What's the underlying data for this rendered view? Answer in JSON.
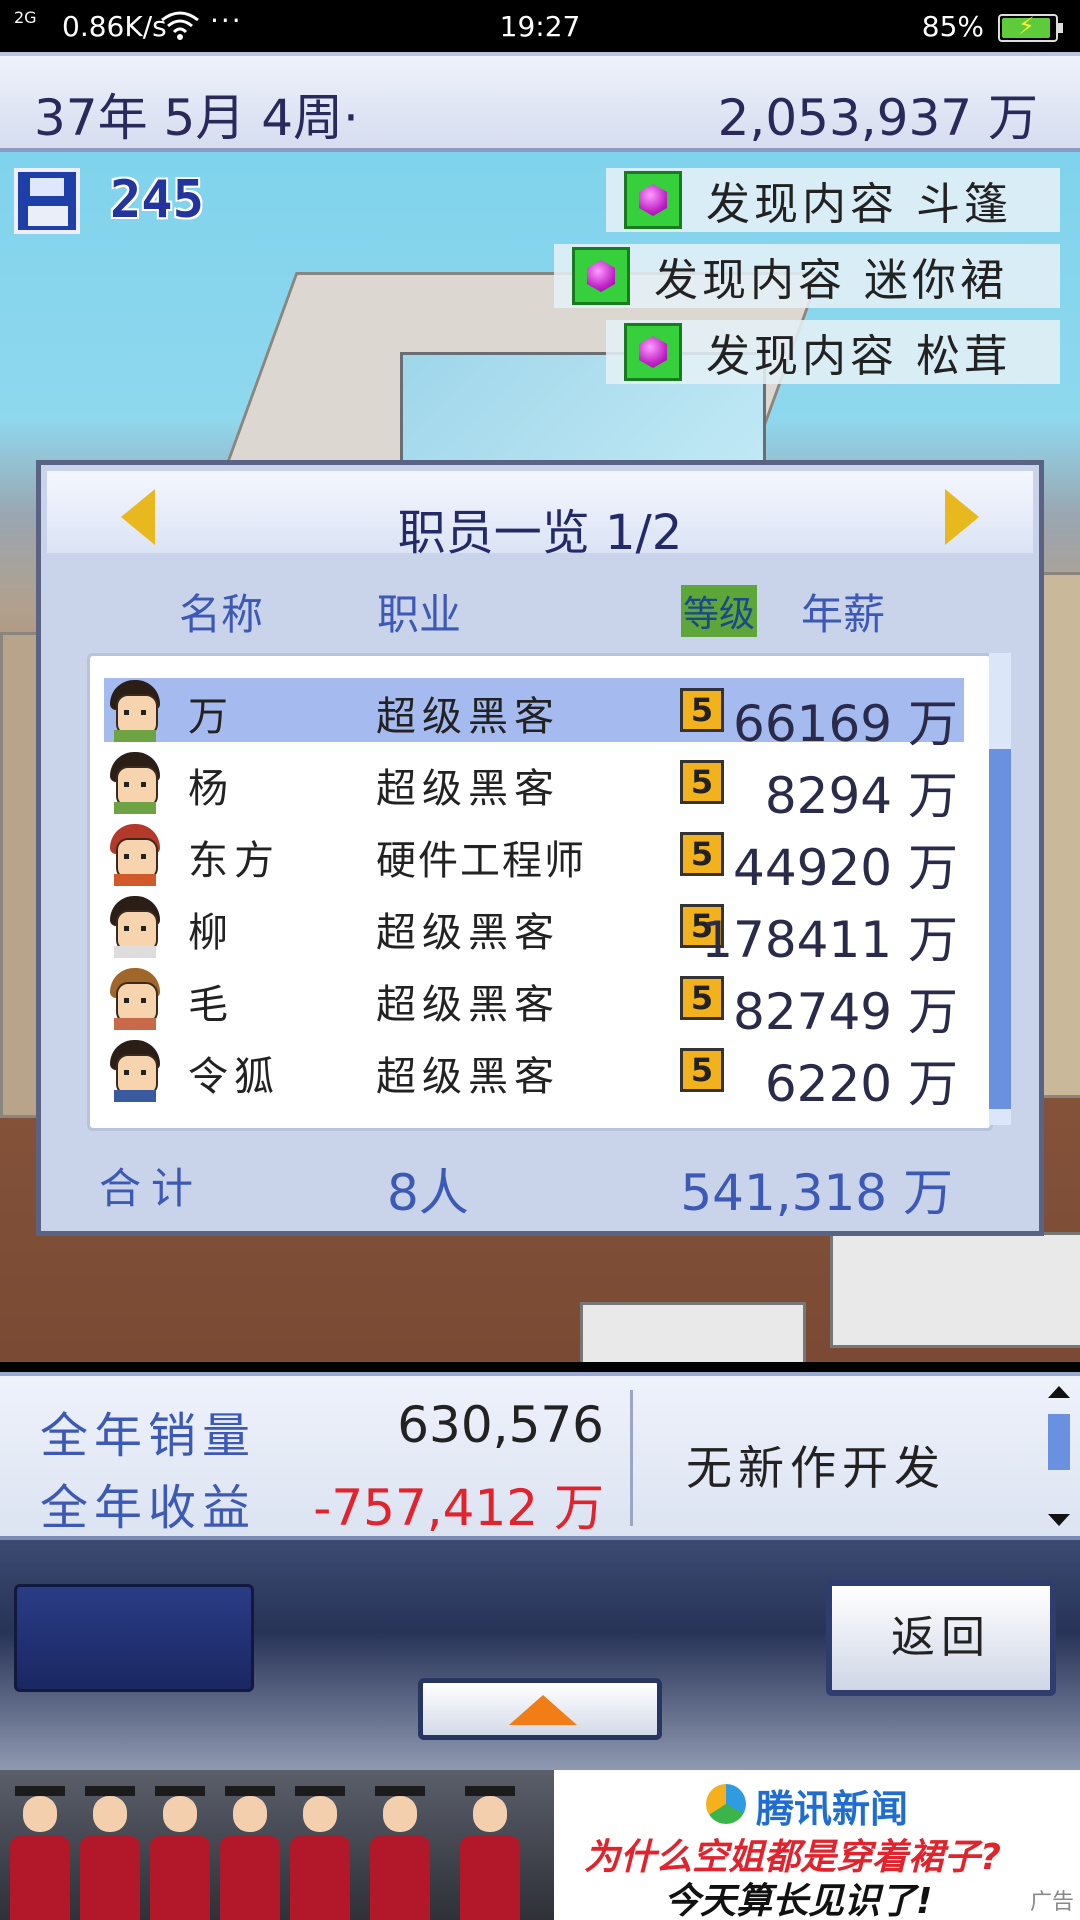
{
  "status_bar": {
    "signal": "2G",
    "net_speed": "0.86K/s",
    "more": "···",
    "time": "19:27",
    "battery": "85%",
    "battery_level": 0.85
  },
  "top_bar": {
    "date": "37年 5月 4周·",
    "funds": "2,053,937 万"
  },
  "hud": {
    "save_count": "245",
    "notifications": [
      {
        "text": "发现内容 斗篷"
      },
      {
        "text": "发现内容 迷你裙"
      },
      {
        "text": "发现内容 松茸"
      }
    ]
  },
  "staff_panel": {
    "title": "职员一览 1/2",
    "headers": {
      "name": "名称",
      "job": "职业",
      "level": "等级",
      "salary": "年薪"
    },
    "rows": [
      {
        "name": "万",
        "job": "超级黑客",
        "level": "5",
        "salary": "66169 万",
        "selected": true
      },
      {
        "name": "杨",
        "job": "超级黑客",
        "level": "5",
        "salary": "8294 万"
      },
      {
        "name": "东方",
        "job": "硬件工程师",
        "level": "5",
        "salary": "44920 万"
      },
      {
        "name": "柳",
        "job": "超级黑客",
        "level": "5",
        "salary": "178411 万"
      },
      {
        "name": "毛",
        "job": "超级黑客",
        "level": "5",
        "salary": "82749 万"
      },
      {
        "name": "令狐",
        "job": "超级黑客",
        "level": "5",
        "salary": "6220 万"
      }
    ],
    "total_label": "合计",
    "total_count": "8人",
    "total_salary": "541,318 万"
  },
  "year_info": {
    "sales_label": "全年销量",
    "sales_value": "630,576",
    "profit_label": "全年收益",
    "profit_value": "-757,412 万",
    "dev_status": "无新作开发",
    "colors": {
      "label": "#3d59b6",
      "negative": "#e0232c"
    }
  },
  "controls": {
    "back_label": "返回",
    "up_icon": "up-arrow-icon"
  },
  "ad": {
    "brand": "腾讯新闻",
    "headline1": "为什么空姐都是穿着裙子?",
    "headline2": "今天算长见识了!",
    "tag": "广告"
  }
}
